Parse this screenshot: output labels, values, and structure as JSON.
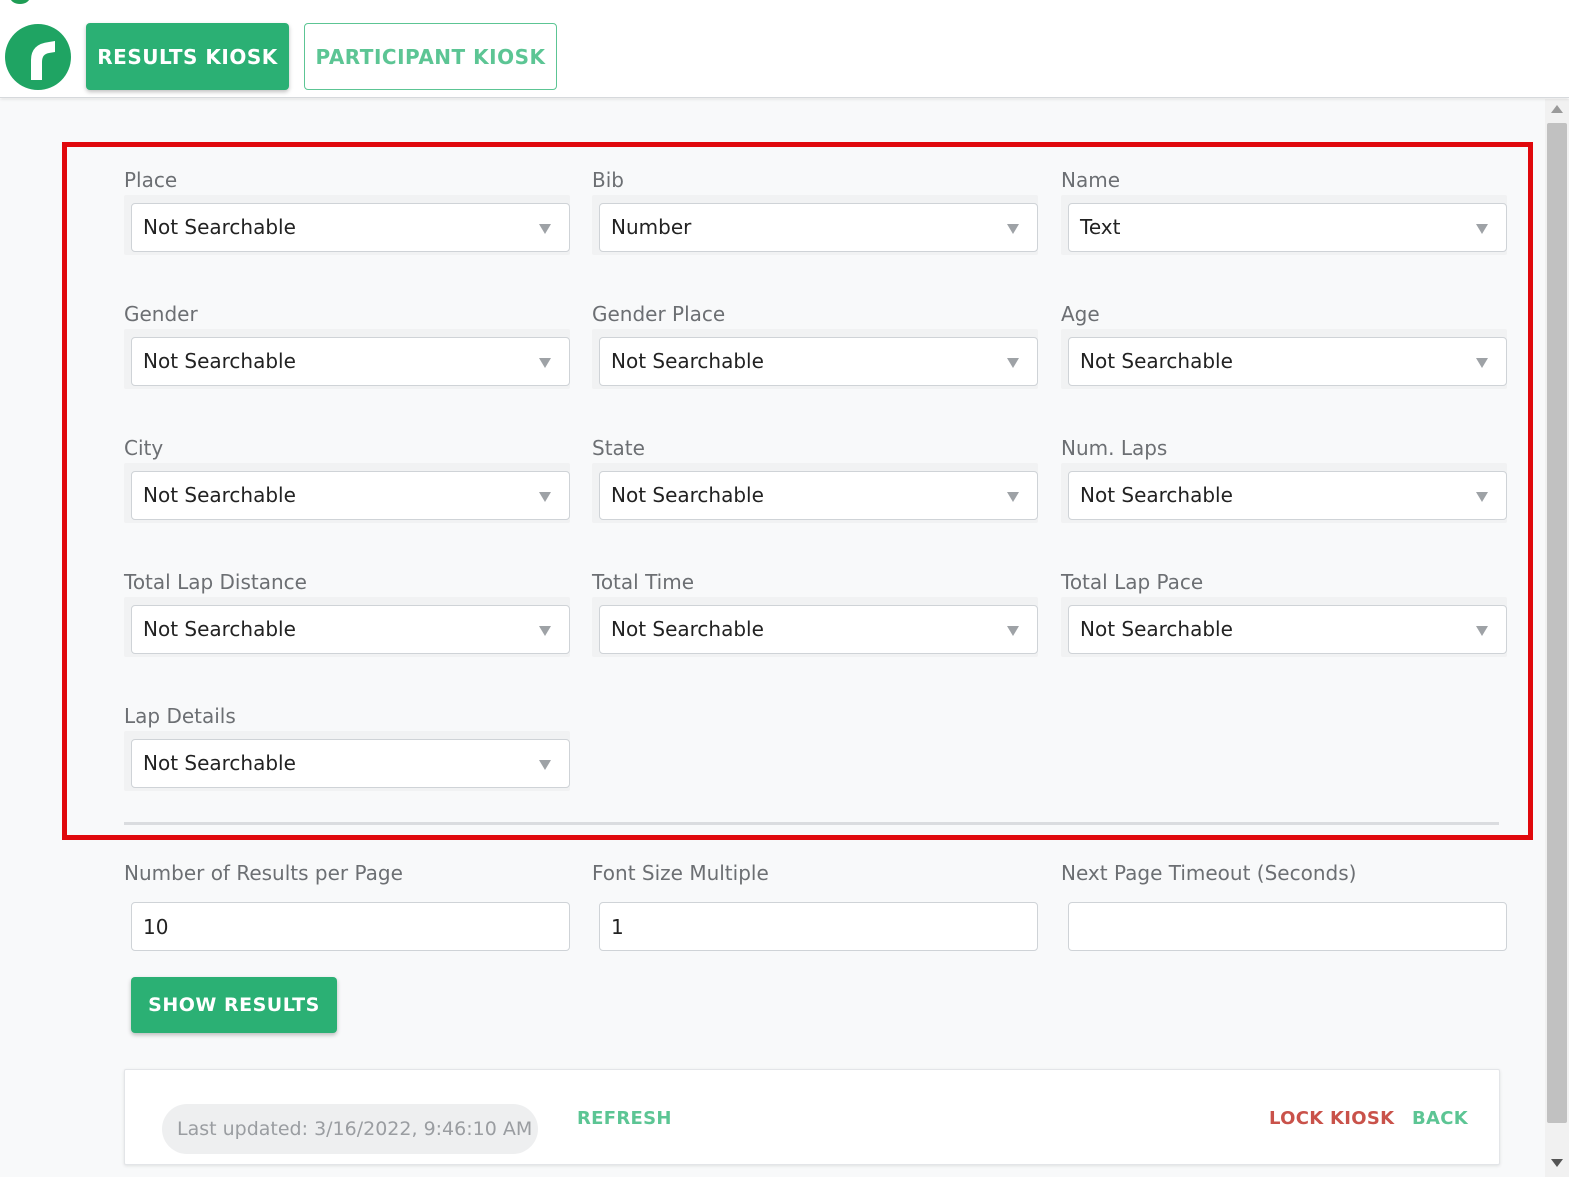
{
  "colors": {
    "accent": "#2bb074",
    "accent_light": "#5cc594",
    "danger": "#c9524a",
    "highlight": "#e0080c"
  },
  "header": {
    "logo_icon": "app-logo-icon",
    "results_kiosk_label": "RESULTS KIOSK",
    "participant_kiosk_label": "PARTICIPANT KIOSK"
  },
  "fields": [
    {
      "label": "Place",
      "value": "Not Searchable"
    },
    {
      "label": "Bib",
      "value": "Number"
    },
    {
      "label": "Name",
      "value": "Text"
    },
    {
      "label": "Gender",
      "value": "Not Searchable"
    },
    {
      "label": "Gender Place",
      "value": "Not Searchable"
    },
    {
      "label": "Age",
      "value": "Not Searchable"
    },
    {
      "label": "City",
      "value": "Not Searchable"
    },
    {
      "label": "State",
      "value": "Not Searchable"
    },
    {
      "label": "Num. Laps",
      "value": "Not Searchable"
    },
    {
      "label": "Total Lap Distance",
      "value": "Not Searchable"
    },
    {
      "label": "Total Time",
      "value": "Not Searchable"
    },
    {
      "label": "Total Lap Pace",
      "value": "Not Searchable"
    },
    {
      "label": "Lap Details",
      "value": "Not Searchable"
    }
  ],
  "settings": {
    "results_per_page_label": "Number of Results per Page",
    "results_per_page_value": "10",
    "font_size_label": "Font Size Multiple",
    "font_size_value": "1",
    "timeout_label": "Next Page Timeout (Seconds)",
    "timeout_value": ""
  },
  "actions": {
    "show_results_label": "SHOW RESULTS"
  },
  "footer": {
    "last_updated": "Last updated: 3/16/2022, 9:46:10 AM",
    "refresh_label": "REFRESH",
    "lock_kiosk_label": "LOCK KIOSK",
    "back_label": "BACK"
  }
}
